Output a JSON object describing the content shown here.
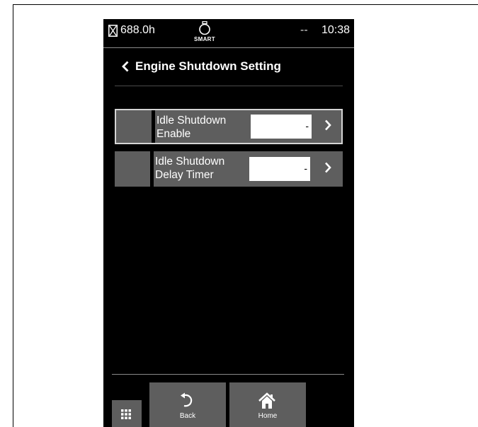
{
  "status_bar": {
    "hours": "688.0h",
    "smart_label": "SMART",
    "indicator": "--",
    "clock": "10:38",
    "icons": [
      "hourglass-icon",
      "smart-engine-icon"
    ]
  },
  "header": {
    "title": "Engine Shutdown Setting",
    "back_icon": "chevron-left-icon"
  },
  "settings": [
    {
      "label_line1": "Idle Shutdown",
      "label_line2": "Enable",
      "value": "-",
      "selected": true
    },
    {
      "label_line1": "Idle Shutdown",
      "label_line2": "Delay Timer",
      "value": "-",
      "selected": false
    }
  ],
  "bottom_bar": {
    "menu_icon": "grid-icon",
    "back_label": "Back",
    "home_label": "Home"
  },
  "colors": {
    "screen_background": "#000000",
    "button_gray": "#5e5e5e",
    "selected_border": "#d4d4d4",
    "text": "#ffffff"
  }
}
